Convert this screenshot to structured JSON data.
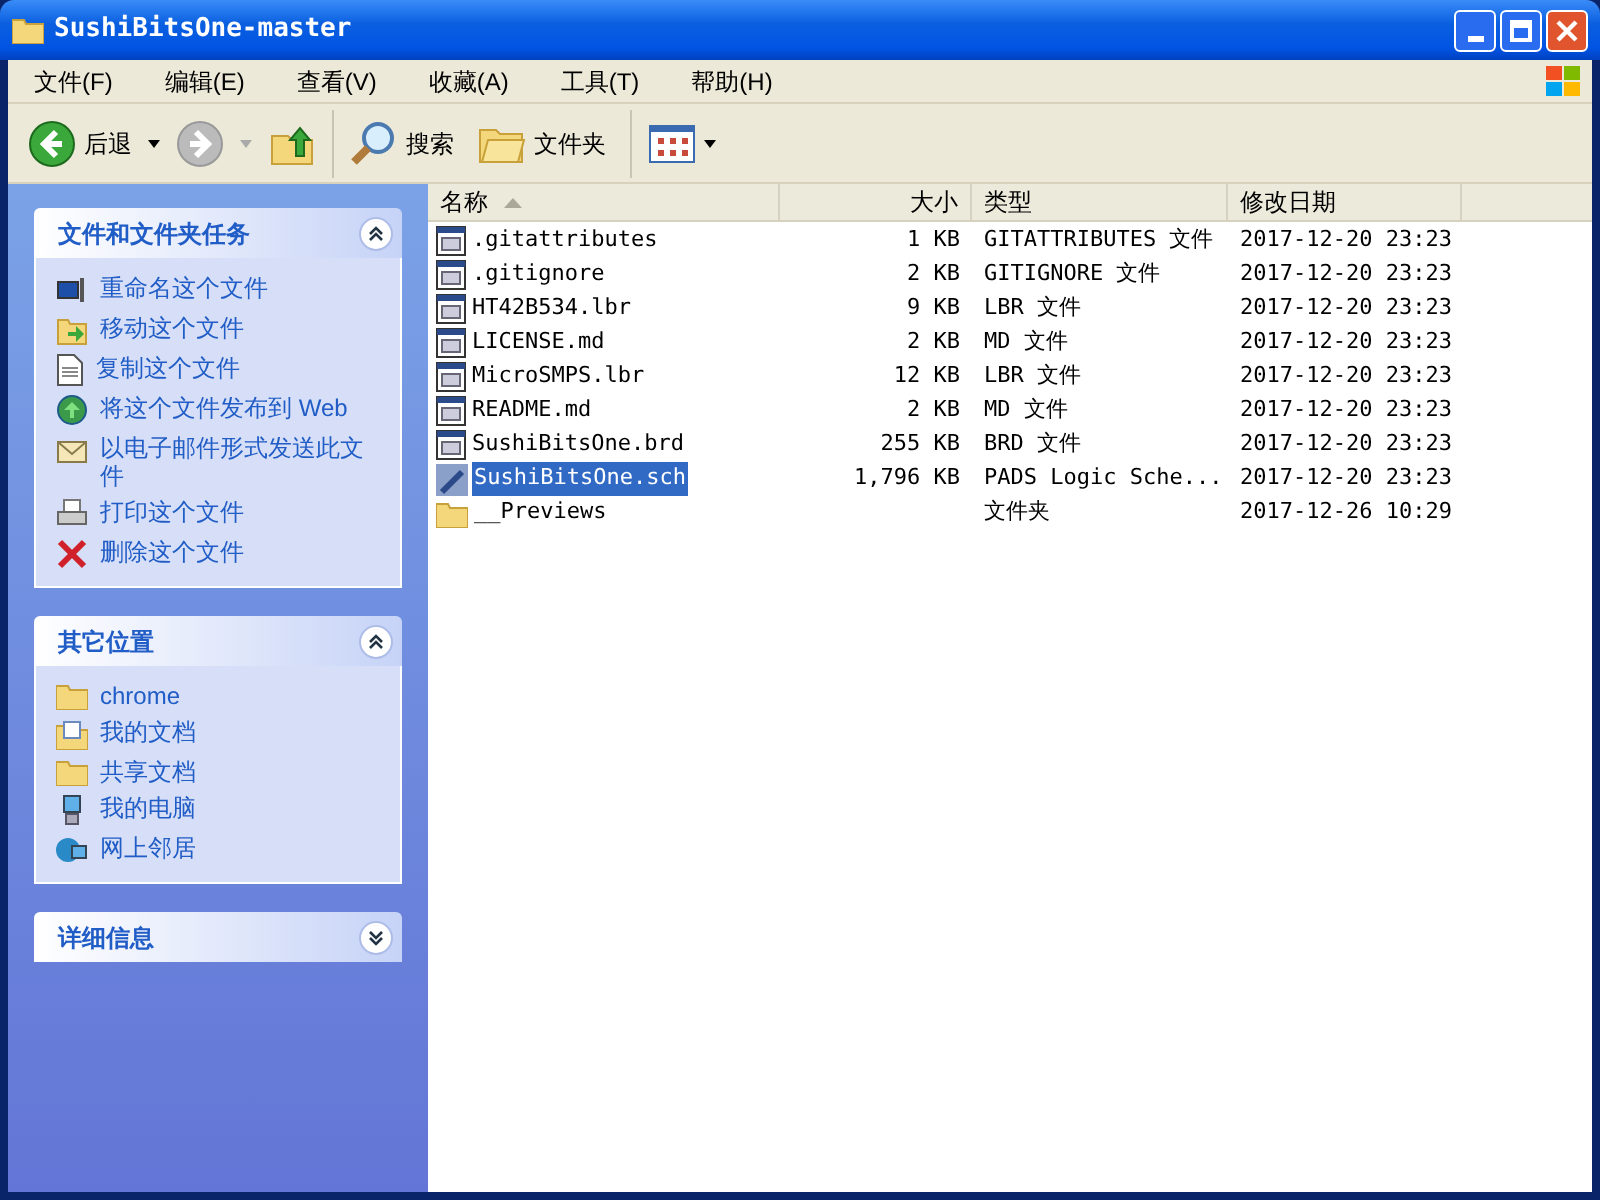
{
  "window": {
    "title": "SushiBitsOne-master"
  },
  "menu": [
    {
      "label": "文件(F)"
    },
    {
      "label": "编辑(E)"
    },
    {
      "label": "查看(V)"
    },
    {
      "label": "收藏(A)"
    },
    {
      "label": "工具(T)"
    },
    {
      "label": "帮助(H)"
    }
  ],
  "toolbar": [
    {
      "kind": "back",
      "label": "后退",
      "disabled": false
    },
    {
      "kind": "forward",
      "disabled": true
    },
    {
      "kind": "up"
    },
    {
      "kind": "search",
      "label": "搜索"
    },
    {
      "kind": "folders",
      "label": "文件夹"
    },
    {
      "kind": "views"
    }
  ],
  "panels": [
    {
      "title": "文件和文件夹任务",
      "expanded": true,
      "items": [
        {
          "label": "重命名这个文件"
        },
        {
          "label": "移动这个文件"
        },
        {
          "label": "复制这个文件"
        },
        {
          "label": "将这个文件发布到 Web"
        },
        {
          "label": "以电子邮件形式发送此文件"
        },
        {
          "label": "打印这个文件"
        },
        {
          "label": "删除这个文件"
        }
      ]
    },
    {
      "title": "其它位置",
      "expanded": true,
      "items": [
        {
          "label": "chrome"
        },
        {
          "label": "我的文档"
        },
        {
          "label": "共享文档"
        },
        {
          "label": "我的电脑"
        },
        {
          "label": "网上邻居"
        }
      ]
    },
    {
      "title": "详细信息",
      "expanded": false
    }
  ],
  "table": {
    "columns": [
      {
        "label": "名称",
        "sorted": true
      },
      {
        "label": "大小",
        "sorted": false
      },
      {
        "label": "类型",
        "sorted": false
      },
      {
        "label": "修改日期",
        "sorted": false
      }
    ],
    "rows": [
      {
        "kind": "file",
        "name": ".gitattributes",
        "size": "1 KB",
        "type": "GITATTRIBUTES 文件",
        "modified": "2017-12-20 23:23",
        "selected": false
      },
      {
        "kind": "file",
        "name": ".gitignore",
        "size": "2 KB",
        "type": "GITIGNORE 文件",
        "modified": "2017-12-20 23:23",
        "selected": false
      },
      {
        "kind": "file",
        "name": "HT42B534.lbr",
        "size": "9 KB",
        "type": "LBR 文件",
        "modified": "2017-12-20 23:23",
        "selected": false
      },
      {
        "kind": "file",
        "name": "LICENSE.md",
        "size": "2 KB",
        "type": "MD 文件",
        "modified": "2017-12-20 23:23",
        "selected": false
      },
      {
        "kind": "file",
        "name": "MicroSMPS.lbr",
        "size": "12 KB",
        "type": "LBR 文件",
        "modified": "2017-12-20 23:23",
        "selected": false
      },
      {
        "kind": "file",
        "name": "README.md",
        "size": "2 KB",
        "type": "MD 文件",
        "modified": "2017-12-20 23:23",
        "selected": false
      },
      {
        "kind": "file",
        "name": "SushiBitsOne.brd",
        "size": "255 KB",
        "type": "BRD 文件",
        "modified": "2017-12-20 23:23",
        "selected": false
      },
      {
        "kind": "pads",
        "name": "SushiBitsOne.sch",
        "size": "1,796 KB",
        "type": "PADS Logic Sche...",
        "modified": "2017-12-20 23:23",
        "selected": true
      },
      {
        "kind": "folder",
        "name": "__Previews",
        "type": "文件夹",
        "modified": "2017-12-26 10:29",
        "selected": false
      }
    ]
  }
}
